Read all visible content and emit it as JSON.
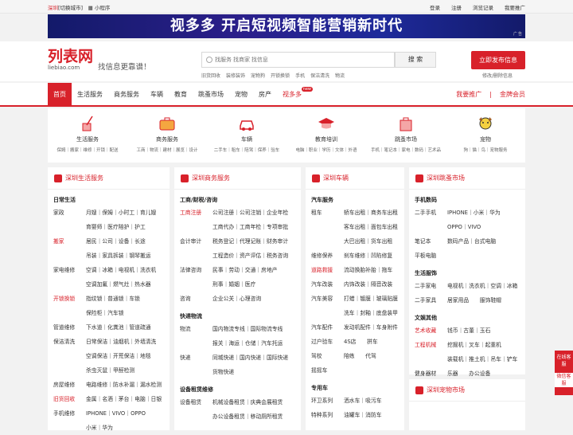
{
  "topbar": {
    "city": "深圳",
    "switch_city": "[切换城市]",
    "mini": "小程序",
    "links": [
      "登录",
      "注册",
      "浏览记录",
      "我要推广"
    ]
  },
  "banner": {
    "text": "视多多 开启短视频智能营销新时代",
    "ad": "广告"
  },
  "header": {
    "logo": "列表网",
    "logo_sub": "liebiao.com",
    "slogan": "找信息更靠谱！",
    "search_placeholder": "找服务 找商家 找信息",
    "search_button": "搜 索",
    "hot": [
      "旧货回收",
      "装修装饰",
      "宠物狗",
      "开锁换锁",
      "手机",
      "保洁清洗",
      "物流"
    ],
    "publish": "立即发布信息",
    "manage": "修改/删除信息"
  },
  "nav": {
    "items": [
      "首页",
      "生活服务",
      "商务服务",
      "车辆",
      "教育",
      "跳蚤市场",
      "宠物",
      "房产",
      "视多多"
    ],
    "badge": "new",
    "right": [
      "我要推广",
      "金牌会员"
    ]
  },
  "cats": [
    {
      "title": "生活服务",
      "sub": "保姆｜搬家｜维修｜开锁｜配送"
    },
    {
      "title": "商务服务",
      "sub": "工商｜物流｜建材｜展览｜设计"
    },
    {
      "title": "车辆",
      "sub": "二手车｜租车｜陪驾｜保养｜验车"
    },
    {
      "title": "教育培训",
      "sub": "电脑｜职业｜学历｜文体｜外语"
    },
    {
      "title": "跳蚤市场",
      "sub": "手机｜笔记本｜家电｜数码｜艺术品"
    },
    {
      "title": "宠物",
      "sub": "狗｜猫｜鸟｜宠物服务"
    }
  ],
  "panel1": {
    "title": "深圳生活服务",
    "sec": "日常生活",
    "rows": [
      {
        "k": "家政",
        "v": "月嫂｜保姆｜小时工｜育儿嫂"
      },
      {
        "k": "",
        "v": "育婴师｜医疗陪护｜护工"
      },
      {
        "k": "搬家",
        "v": "居民｜公司｜设备｜长途"
      },
      {
        "k": "",
        "v": "吊装｜家具拆装｜钢琴搬运"
      },
      {
        "k": "家电维修",
        "v": "空调｜冰箱｜电视机｜洗衣机"
      },
      {
        "k": "",
        "v": "空调加氟｜燃气灶｜热水器"
      },
      {
        "k": "开锁换锁",
        "v": "指纹锁｜普通锁｜车锁"
      },
      {
        "k": "",
        "v": "保险柜｜汽车锁"
      },
      {
        "k": "管道维修",
        "v": "下水道｜化粪池｜管道疏通"
      },
      {
        "k": "保洁清洗",
        "v": "日常保洁｜油烟机｜外墙清洗"
      },
      {
        "k": "",
        "v": "空调保洁｜开荒保洁｜地毯"
      },
      {
        "k": "",
        "v": "杀虫灭鼠｜甲醛检测"
      },
      {
        "k": "房屋维修",
        "v": "电路维修｜防水补漏｜漏水检测"
      },
      {
        "k": "旧货回收",
        "v": "金属｜名酒｜茅台｜电脑｜日银"
      },
      {
        "k": "手机维修",
        "v": "IPHONE｜VIVO｜OPPO"
      },
      {
        "k": "",
        "v": "小米｜华为"
      }
    ]
  },
  "panel2": {
    "title": "深圳商务服务",
    "sec": "工商/财税/咨询",
    "rows": [
      {
        "k": "工商注册",
        "v": "公司注册｜公司注销｜企业年检"
      },
      {
        "k": "",
        "v": "工商代办｜工商年检｜专项审批"
      },
      {
        "k": "会计审计",
        "v": "税务登记｜代理记账｜财务审计"
      },
      {
        "k": "",
        "v": "工程造价｜资产评估｜税务咨询"
      },
      {
        "k": "法律咨询",
        "v": "民事｜劳动｜交通｜房地产"
      },
      {
        "k": "",
        "v": "刑事｜婚姻｜医疗"
      },
      {
        "k": "咨询",
        "v": "企业公关｜心理咨询"
      }
    ],
    "sec2": "快递物流",
    "rows2": [
      {
        "k": "物流",
        "v": "国内物流专线｜国际物流专线"
      },
      {
        "k": "",
        "v": "报关｜海运｜仓储｜汽车托运"
      },
      {
        "k": "快递",
        "v": "同城快递｜国内快递｜国际快递"
      },
      {
        "k": "",
        "v": "货物快递"
      }
    ],
    "sec3": "设备租赁维修",
    "rows3": [
      {
        "k": "设备租赁",
        "v": "机械设备租赁｜庆典会展租赁"
      },
      {
        "k": "",
        "v": "办公设备租赁｜移动厕所租赁"
      }
    ]
  },
  "panel3": {
    "title": "深圳车辆",
    "sec": "汽车服务",
    "rows": [
      {
        "k": "租车",
        "v": "轿车出租｜商务车出租"
      },
      {
        "k": "",
        "v": "客车出租｜面包车出租"
      },
      {
        "k": "",
        "v": "大巴出租｜货车出租"
      },
      {
        "k": "维修保养",
        "v": "刹车维修｜凹陷修复"
      },
      {
        "k": "道路救援",
        "v": "流动换胎补胎｜拖车"
      },
      {
        "k": "汽车改装",
        "v": "内饰改装｜隔音改装"
      },
      {
        "k": "汽车美容",
        "v": "打蜡｜镀膜｜玻璃贴膜"
      },
      {
        "k": "",
        "v": "洗车｜封釉｜底盘装甲"
      },
      {
        "k": "汽车配件",
        "v": "发动机配件｜车身附件"
      },
      {
        "k": "过户验车",
        "v": "4S店　　拼车"
      },
      {
        "k": "驾校",
        "v": "陪练　　代驾"
      },
      {
        "k": "摇摇车",
        "v": ""
      }
    ],
    "sec2": "专用车",
    "rows2": [
      {
        "k": "环卫系列",
        "v": "洒水车｜吸污车"
      },
      {
        "k": "特种系列",
        "v": "油罐车｜消防车"
      }
    ]
  },
  "panel4": {
    "title": "深圳跳蚤市场",
    "sec": "手机数码",
    "rows": [
      {
        "k": "二手手机",
        "v": "IPHONE｜小米｜华为"
      },
      {
        "k": "",
        "v": "OPPO｜VIVO"
      },
      {
        "k": "笔记本",
        "v": "数码产品｜台式电脑"
      },
      {
        "k": "平板电脑",
        "v": ""
      }
    ],
    "sec2": "生活服饰",
    "rows2": [
      {
        "k": "二手家电",
        "v": "电视机｜洗衣机｜空调｜冰箱"
      },
      {
        "k": "二手家具",
        "v": "居家用品　　服饰鞋帽"
      }
    ],
    "sec3": "文娱其他",
    "rows3": [
      {
        "k": "艺术收藏",
        "v": "钱币｜古董｜玉石"
      },
      {
        "k": "工程机械",
        "v": "挖掘机｜叉车｜起重机"
      },
      {
        "k": "",
        "v": "装载机｜推土机｜吊车｜铲车"
      },
      {
        "k": "健身器材",
        "v": "乐器　　办公设备"
      }
    ],
    "title2": "深圳宠物市场"
  },
  "side": {
    "a": "在线客服",
    "b": "微信客服"
  },
  "colors": {
    "accent": "#d8212a"
  }
}
